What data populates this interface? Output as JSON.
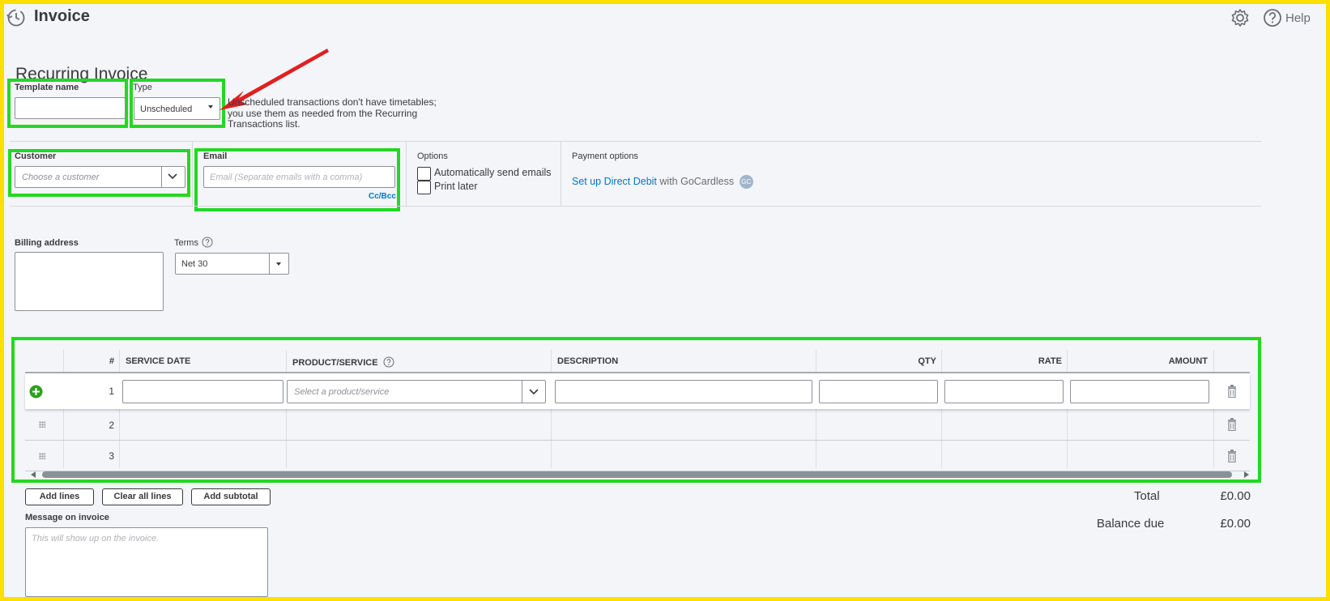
{
  "header": {
    "title": "Invoice",
    "help_label": "Help",
    "icons": [
      "recent-history-icon",
      "gear-icon",
      "help-question-icon"
    ]
  },
  "form": {
    "section_title": "Recurring Invoice",
    "template_name": {
      "label": "Template name",
      "value": ""
    },
    "type": {
      "label": "Type",
      "value": "Unscheduled"
    },
    "type_note": [
      "Unscheduled transactions don't have timetables;",
      "you use them as needed from the Recurring",
      "Transactions list."
    ],
    "customer": {
      "label": "Customer",
      "placeholder": "Choose a customer"
    },
    "email": {
      "label": "Email",
      "placeholder": "Email (Separate emails with a comma)",
      "cc_bcc": "Cc/Bcc"
    },
    "options": {
      "label": "Options",
      "auto_send": "Automatically send emails",
      "print_later": "Print later"
    },
    "payment": {
      "label": "Payment options",
      "link": "Set up Direct Debit",
      "suffix": "with GoCardless",
      "badge": "GC"
    },
    "billing_address": {
      "label": "Billing address",
      "value": ""
    },
    "terms": {
      "label": "Terms",
      "value": "Net 30"
    }
  },
  "table": {
    "columns": [
      "#",
      "SERVICE DATE",
      "PRODUCT/SERVICE",
      "DESCRIPTION",
      "QTY",
      "RATE",
      "AMOUNT"
    ],
    "rows": [
      "1",
      "2",
      "3"
    ],
    "product_placeholder": "Select a product/service"
  },
  "actions": {
    "add_lines": "Add lines",
    "clear_all_lines": "Clear all lines",
    "add_subtotal": "Add subtotal"
  },
  "message": {
    "label": "Message on invoice",
    "placeholder": "This will show up on the invoice."
  },
  "totals": {
    "total_label": "Total",
    "total_value": "£0.00",
    "balance_label": "Balance due",
    "balance_value": "£0.00"
  },
  "colors": {
    "highlight_frame": "#ffdf00",
    "highlight_box": "#22d822",
    "arrow": "#e02020",
    "link": "#0077c5",
    "add_icon": "#2ca01c"
  }
}
